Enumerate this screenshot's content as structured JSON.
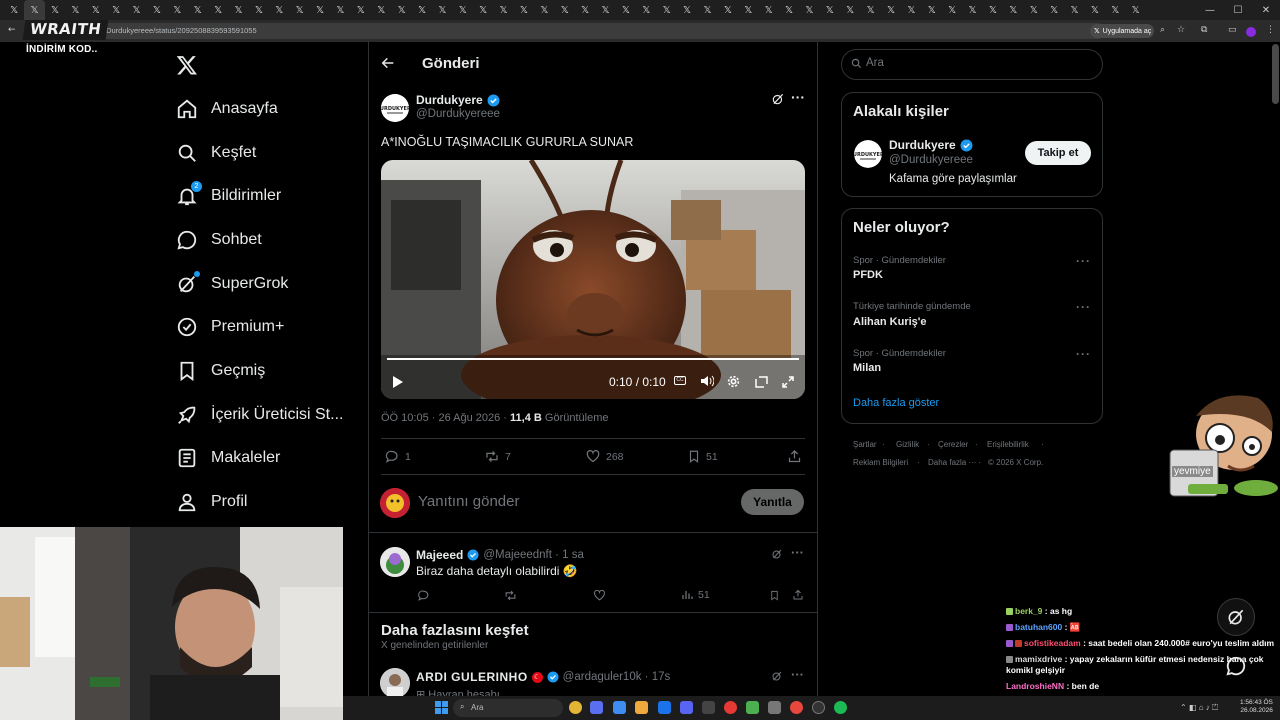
{
  "browser": {
    "url": "x.com/Durdukyereee/status/2092508839593591055",
    "open_app_label": "Uygulamada aç",
    "tabs_count": 56
  },
  "overlay": {
    "brand": "WRAITH",
    "discount": "İNDİRİM KOD..",
    "sticker_text": "yevmiye"
  },
  "nav": {
    "items": [
      {
        "label": "Anasayfa",
        "icon": "home-icon"
      },
      {
        "label": "Keşfet",
        "icon": "search-icon"
      },
      {
        "label": "Bildirimler",
        "icon": "bell-icon",
        "badge": "2"
      },
      {
        "label": "Sohbet",
        "icon": "chat-icon"
      },
      {
        "label": "SuperGrok",
        "icon": "grok-icon"
      },
      {
        "label": "Premium+",
        "icon": "verified-icon"
      },
      {
        "label": "Geçmiş",
        "icon": "bookmark-icon"
      },
      {
        "label": "İçerik Üreticisi St...",
        "icon": "rocket-icon"
      },
      {
        "label": "Makaleler",
        "icon": "article-icon"
      },
      {
        "label": "Profil",
        "icon": "profile-icon"
      }
    ]
  },
  "header": {
    "title": "Gönderi"
  },
  "post": {
    "author": "Durdukyere",
    "handle": "@Durdukyereee",
    "text": "A*INOĞLU TAŞIMACILIK GURURLA SUNAR",
    "video_time": "0:10 / 0:10",
    "video_progress": 1.0,
    "timestamp": "ÖÖ 10:05 · 26 Ağu 2026 · ",
    "views": "11,4 B",
    "views_label": " Görüntüleme",
    "replies": "1",
    "reposts": "7",
    "likes": "268",
    "bookmarks": "51"
  },
  "reply_box": {
    "placeholder": "Yanıtını gönder",
    "button": "Yanıtla"
  },
  "comment": {
    "author": "Majeeed",
    "handle": "@Majeeednft · 1 sa",
    "text": "Biraz daha detaylı olabilirdi 🤣",
    "views": "51"
  },
  "discover": {
    "title": "Daha fazlasını keşfet",
    "subtitle": "X genelinden getirilenler",
    "author": "ARDI GULERINHO",
    "handle": "@ardaguler10k · 17s",
    "sub": "Hayran hesabı"
  },
  "right": {
    "search_placeholder": "Ara",
    "related": {
      "title": "Alakalı kişiler",
      "name": "Durdukyere",
      "handle": "@Durdukyereee",
      "bio": "Kafama göre paylaşımlar",
      "follow": "Takip et"
    },
    "trends": {
      "title": "Neler oluyor?",
      "items": [
        {
          "category": "Spor · Gündemdekiler",
          "name": "PFDK"
        },
        {
          "category": "Türkiye tarihinde gündemde",
          "name": "Alihan Kuriş'e"
        },
        {
          "category": "Spor · Gündemdekiler",
          "name": "Milan"
        }
      ],
      "more": "Daha fazla göster"
    },
    "footer": {
      "row1": [
        "Şartlar",
        "Gizlilik",
        "Çerezler",
        "Erişilebilirlik"
      ],
      "row2": [
        "Reklam Bilgileri",
        "Daha fazla ···",
        "© 2026 X Corp."
      ]
    }
  },
  "chat": [
    {
      "user": "berk_9",
      "msg": " : as hg",
      "color": "#9ad25f"
    },
    {
      "user": "batuhan600",
      "msg": " : 🆎",
      "color": "#5ba4ff"
    },
    {
      "user": "sofistikeadam",
      "msg": " : saat bedeli olan 240.000# euro'yu teslim aldım",
      "color": "#ff4f6e"
    },
    {
      "user": "mamixdrive",
      "msg": " : yapay zekaların küfür etmesi nedensiz bana çok komikl gelşiyir",
      "color": "#dcdcdc"
    },
    {
      "user": "LandroshieNN",
      "msg": " : ben de",
      "color": "#ff6ec7"
    }
  ],
  "taskbar": {
    "search_placeholder": "Ara",
    "time": "1:56:43 ÖS",
    "date": "26.08.2026"
  }
}
